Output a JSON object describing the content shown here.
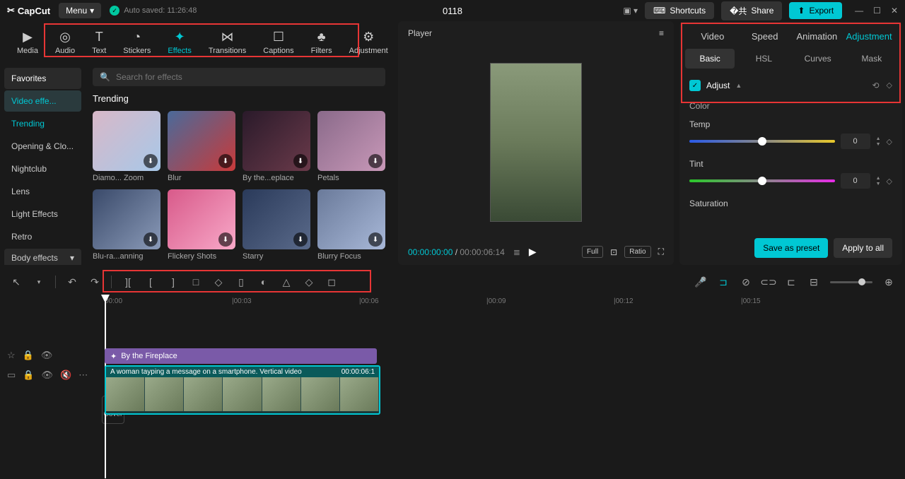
{
  "titlebar": {
    "logo": "CapCut",
    "menu": "Menu",
    "autosave": "Auto saved: 11:26:48",
    "project_title": "0118",
    "shortcuts": "Shortcuts",
    "share": "Share",
    "export": "Export"
  },
  "categories": [
    {
      "label": "Media"
    },
    {
      "label": "Audio"
    },
    {
      "label": "Text"
    },
    {
      "label": "Stickers"
    },
    {
      "label": "Effects"
    },
    {
      "label": "Transitions"
    },
    {
      "label": "Captions"
    },
    {
      "label": "Filters"
    },
    {
      "label": "Adjustment"
    }
  ],
  "sidebar": {
    "favorites": "Favorites",
    "video_effects": "Video effe...",
    "trending": "Trending",
    "opening": "Opening & Clo...",
    "nightclub": "Nightclub",
    "lens": "Lens",
    "light": "Light Effects",
    "retro": "Retro",
    "body_effects": "Body effects"
  },
  "effects": {
    "search_placeholder": "Search for effects",
    "section": "Trending",
    "items": [
      {
        "name": "Diamo... Zoom"
      },
      {
        "name": "Blur"
      },
      {
        "name": "By the...eplace"
      },
      {
        "name": "Petals"
      },
      {
        "name": "Blu-ra...anning"
      },
      {
        "name": "Flickery Shots"
      },
      {
        "name": "Starry"
      },
      {
        "name": "Blurry Focus"
      }
    ]
  },
  "player": {
    "label": "Player",
    "current": "00:00:00:00",
    "duration": "00:00:06:14",
    "full": "Full",
    "ratio": "Ratio"
  },
  "right": {
    "tabs": {
      "video": "Video",
      "speed": "Speed",
      "animation": "Animation",
      "adjustment": "Adjustment"
    },
    "subtabs": {
      "basic": "Basic",
      "hsl": "HSL",
      "curves": "Curves",
      "mask": "Mask"
    },
    "adjust": "Adjust",
    "color": "Color",
    "temp": {
      "label": "Temp",
      "value": "0"
    },
    "tint": {
      "label": "Tint",
      "value": "0"
    },
    "saturation": "Saturation",
    "save_preset": "Save as preset",
    "apply_all": "Apply to all"
  },
  "timeline": {
    "ruler": [
      "00:00",
      "|00:03",
      "|00:06",
      "|00:09",
      "|00:12",
      "|00:15"
    ],
    "effect_clip": "By the Fireplace",
    "video_clip": "A woman tayping a message on a smartphone. Vertical video",
    "video_dur": "00:00:06:1",
    "cover": "Cover"
  }
}
